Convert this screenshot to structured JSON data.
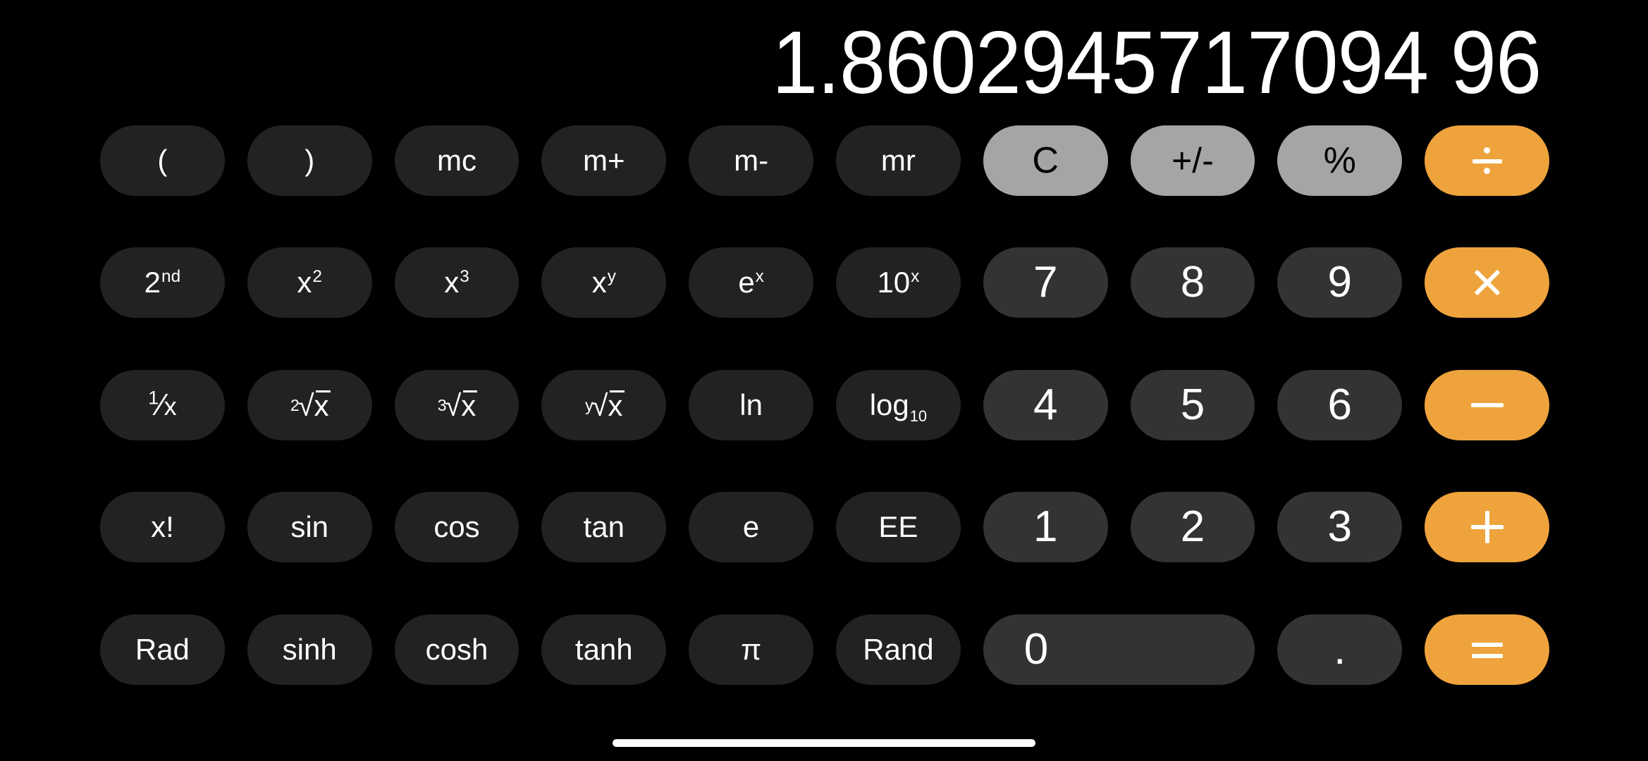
{
  "app": {
    "name": "Calculator",
    "mode": "scientific-landscape",
    "background_color": "#000000"
  },
  "display": {
    "value": "1.8602945717094 96",
    "text_color": "#ffffff"
  },
  "colors": {
    "function_key": "#222222",
    "digit_key": "#333333",
    "utility_key": "#a5a5a5",
    "operator_key": "#efa33c",
    "key_text": "#ffffff",
    "utility_key_text": "#000000"
  },
  "keypad": {
    "rows": [
      {
        "keys": [
          {
            "name": "open-paren",
            "label": "(",
            "type": "fn"
          },
          {
            "name": "close-paren",
            "label": ")",
            "type": "fn"
          },
          {
            "name": "memory-clear",
            "label": "mc",
            "type": "fn"
          },
          {
            "name": "memory-add",
            "label": "m+",
            "type": "fn"
          },
          {
            "name": "memory-subtract",
            "label": "m-",
            "type": "fn"
          },
          {
            "name": "memory-recall",
            "label": "mr",
            "type": "fn"
          },
          {
            "name": "clear",
            "label": "C",
            "type": "util"
          },
          {
            "name": "sign-toggle",
            "label": "+/-",
            "type": "util"
          },
          {
            "name": "percent",
            "label": "%",
            "type": "util"
          },
          {
            "name": "divide",
            "label": "÷",
            "type": "op"
          }
        ]
      },
      {
        "keys": [
          {
            "name": "second-function",
            "label": "2nd",
            "base": "2",
            "sup": "nd",
            "type": "fn"
          },
          {
            "name": "square",
            "label": "x²",
            "base": "x",
            "sup": "2",
            "type": "fn"
          },
          {
            "name": "cube",
            "label": "x³",
            "base": "x",
            "sup": "3",
            "type": "fn"
          },
          {
            "name": "power-y",
            "label": "xʸ",
            "base": "x",
            "sup": "y",
            "type": "fn"
          },
          {
            "name": "exp-e",
            "label": "eˣ",
            "base": "e",
            "sup": "x",
            "type": "fn"
          },
          {
            "name": "exp-ten",
            "label": "10ˣ",
            "base": "10",
            "sup": "x",
            "type": "fn"
          },
          {
            "name": "digit-7",
            "label": "7",
            "type": "digit"
          },
          {
            "name": "digit-8",
            "label": "8",
            "type": "digit"
          },
          {
            "name": "digit-9",
            "label": "9",
            "type": "digit"
          },
          {
            "name": "multiply",
            "label": "×",
            "type": "op"
          }
        ]
      },
      {
        "keys": [
          {
            "name": "reciprocal",
            "label": "1/x",
            "num": "1",
            "den": "x",
            "type": "fn"
          },
          {
            "name": "square-root",
            "label": "2√x",
            "index": "2",
            "type": "fn"
          },
          {
            "name": "cube-root",
            "label": "3√x",
            "index": "3",
            "type": "fn"
          },
          {
            "name": "nth-root",
            "label": "y√x",
            "index": "y",
            "type": "fn"
          },
          {
            "name": "natural-log",
            "label": "ln",
            "type": "fn"
          },
          {
            "name": "log-base-10",
            "label": "log10",
            "base": "log",
            "sub": "10",
            "type": "fn"
          },
          {
            "name": "digit-4",
            "label": "4",
            "type": "digit"
          },
          {
            "name": "digit-5",
            "label": "5",
            "type": "digit"
          },
          {
            "name": "digit-6",
            "label": "6",
            "type": "digit"
          },
          {
            "name": "subtract",
            "label": "−",
            "type": "op"
          }
        ]
      },
      {
        "keys": [
          {
            "name": "factorial",
            "label": "x!",
            "type": "fn"
          },
          {
            "name": "sine",
            "label": "sin",
            "type": "fn"
          },
          {
            "name": "cosine",
            "label": "cos",
            "type": "fn"
          },
          {
            "name": "tangent",
            "label": "tan",
            "type": "fn"
          },
          {
            "name": "euler-e",
            "label": "e",
            "type": "fn"
          },
          {
            "name": "exponent-entry",
            "label": "EE",
            "type": "fn"
          },
          {
            "name": "digit-1",
            "label": "1",
            "type": "digit"
          },
          {
            "name": "digit-2",
            "label": "2",
            "type": "digit"
          },
          {
            "name": "digit-3",
            "label": "3",
            "type": "digit"
          },
          {
            "name": "add",
            "label": "+",
            "type": "op"
          }
        ]
      },
      {
        "keys": [
          {
            "name": "radian-mode",
            "label": "Rad",
            "type": "fn"
          },
          {
            "name": "hyperbolic-sine",
            "label": "sinh",
            "type": "fn"
          },
          {
            "name": "hyperbolic-cosine",
            "label": "cosh",
            "type": "fn"
          },
          {
            "name": "hyperbolic-tangent",
            "label": "tanh",
            "type": "fn"
          },
          {
            "name": "pi",
            "label": "π",
            "type": "fn"
          },
          {
            "name": "random",
            "label": "Rand",
            "type": "fn"
          },
          {
            "name": "digit-0",
            "label": "0",
            "type": "digit",
            "wide": true
          },
          {
            "name": "decimal-point",
            "label": ".",
            "type": "digit"
          },
          {
            "name": "equals",
            "label": "=",
            "type": "op"
          }
        ]
      }
    ]
  },
  "home_indicator": {
    "visible": true,
    "color": "#ffffff"
  }
}
